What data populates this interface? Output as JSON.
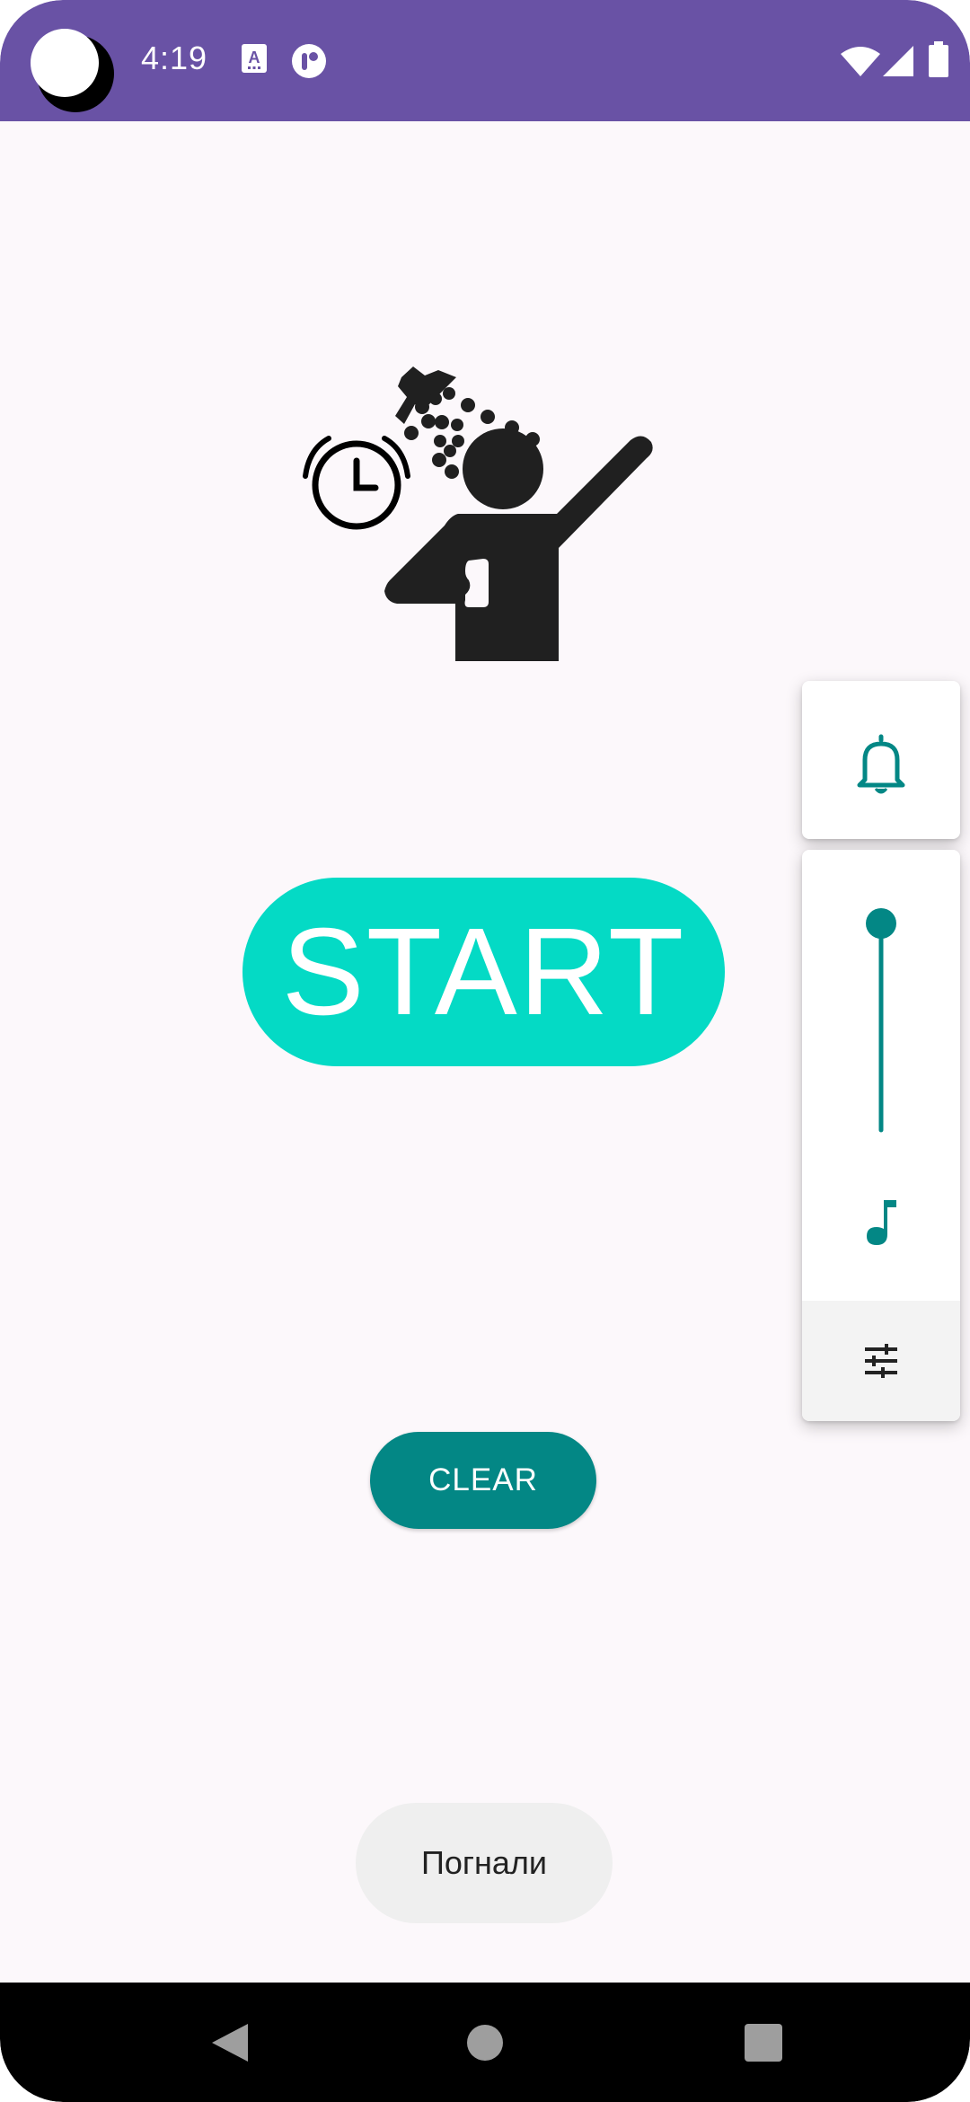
{
  "status_bar": {
    "time": "4:19",
    "background_color": "#6952a5",
    "icons_left": [
      "camera-cutout",
      "text-recognition-icon",
      "app-notification-icon"
    ],
    "icons_right": [
      "wifi-icon",
      "cellular-signal-icon",
      "battery-icon"
    ]
  },
  "hero": {
    "icon": "shower-alarm-illustration"
  },
  "main": {
    "start_label": "START",
    "start_color": "#04dac5",
    "clear_label": "CLEAR",
    "clear_color": "#038785"
  },
  "volume_panel": {
    "ringer_icon": "bell-icon",
    "slider_level": 1.0,
    "stream_icon": "music-note-icon",
    "settings_icon": "tune-sliders-icon",
    "accent_color": "#038785"
  },
  "toast": {
    "message": "Погнали"
  },
  "nav_bar": {
    "buttons": [
      "back-icon",
      "home-icon",
      "recents-icon"
    ]
  }
}
